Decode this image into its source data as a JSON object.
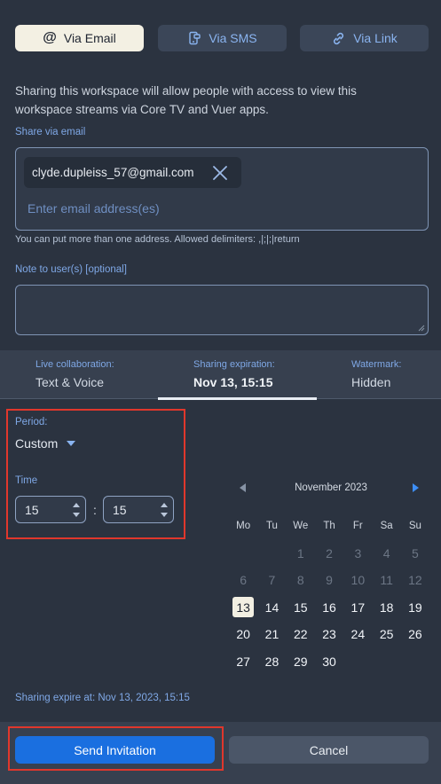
{
  "tabs": {
    "email": "Via Email",
    "sms": "Via SMS",
    "link": "Via Link"
  },
  "intro": "Sharing this workspace will allow people with access to view this workspace streams via Core TV and Vuer apps.",
  "share_email": {
    "label": "Share via email",
    "chip_email": "clyde.dupleiss_57@gmail.com",
    "placeholder": "Enter email address(es)",
    "hint": "You can put more than one address. Allowed delimiters: ,|;|;|return"
  },
  "note": {
    "label": "Note to user(s) [optional]",
    "value": ""
  },
  "summary": {
    "live_title": "Live collaboration:",
    "live_value": "Text & Voice",
    "expire_title": "Sharing expiration:",
    "expire_value": "Nov 13, 15:15",
    "watermark_title": "Watermark:",
    "watermark_value": "Hidden"
  },
  "period": {
    "label": "Period:",
    "value": "Custom"
  },
  "time": {
    "label": "Time",
    "hour": "15",
    "minute": "15",
    "separator": ":"
  },
  "calendar": {
    "month": "November 2023",
    "weekdays": [
      "Mo",
      "Tu",
      "We",
      "Th",
      "Fr",
      "Sa",
      "Su"
    ],
    "leading_blank": 2,
    "days": [
      "1",
      "2",
      "3",
      "4",
      "5",
      "6",
      "7",
      "8",
      "9",
      "10",
      "11",
      "12",
      "13",
      "14",
      "15",
      "16",
      "17",
      "18",
      "19",
      "20",
      "21",
      "22",
      "23",
      "24",
      "25",
      "26",
      "27",
      "28",
      "29",
      "30"
    ],
    "disabled_through": 12,
    "selected": "13"
  },
  "expire_text": "Sharing expire at: Nov 13, 2023, 15:15",
  "buttons": {
    "send": "Send Invitation",
    "cancel": "Cancel"
  },
  "colors": {
    "background": "#2b3340",
    "accent": "#1a6fe0",
    "highlight_box": "#e0372c",
    "label_blue": "#7fa8e6"
  }
}
